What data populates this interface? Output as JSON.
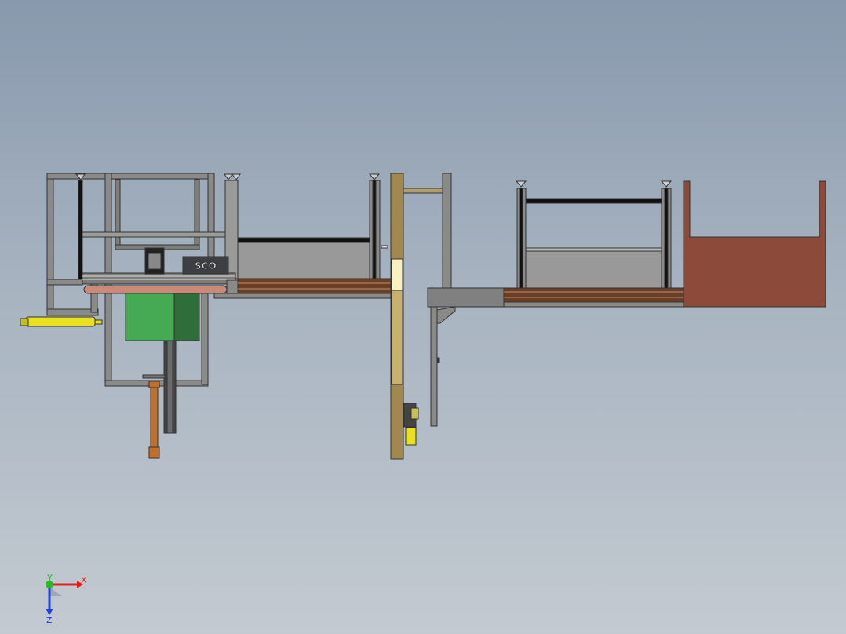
{
  "viewport": {
    "background_top": "#8899ad",
    "background_bottom": "#c3cad1",
    "model": {
      "frame_color": "#7a7a78",
      "conveyor_color": "#6b3f26",
      "roller_color": "#c98a7a",
      "motor_color": "#46aa55",
      "cylinder_color": "#e8e020",
      "vertical_post_color": "#a08850",
      "bin_color": "#8b4a3a",
      "actuator_color": "#c0702a",
      "motor_logo": "SCO"
    }
  },
  "triad": {
    "x_label": "X",
    "y_label": "Y",
    "z_label": "Z",
    "x_color": "#e02020",
    "y_color": "#20c020",
    "z_color": "#2040e0"
  }
}
